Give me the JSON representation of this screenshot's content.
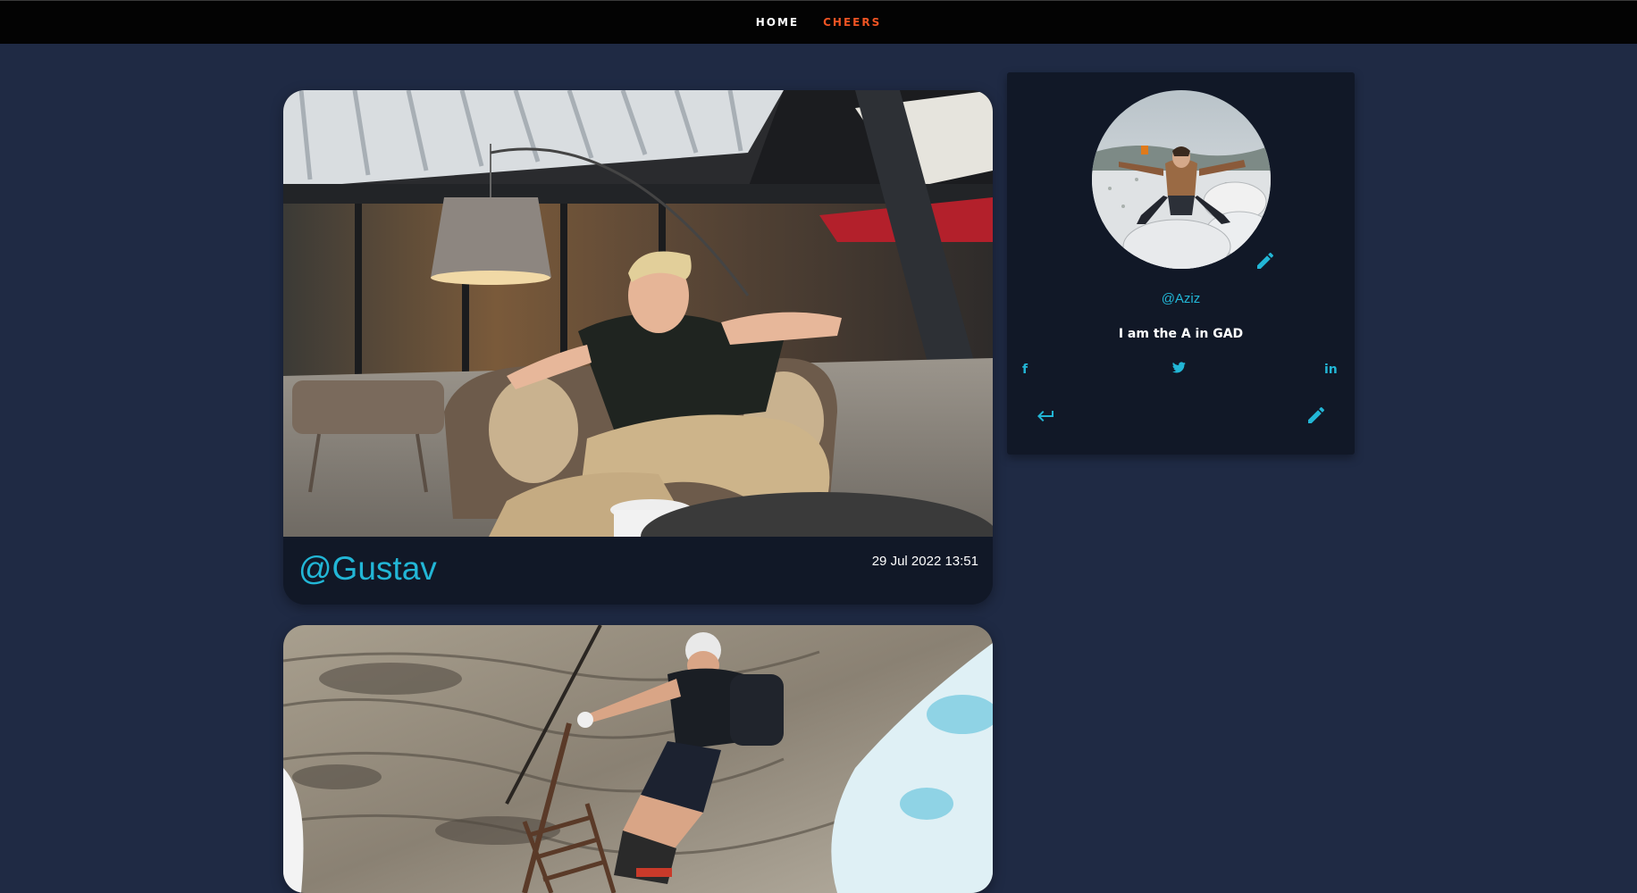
{
  "nav": {
    "home_label": "HOME",
    "cheers_label": "CHEERS"
  },
  "colors": {
    "background": "#1f2a44",
    "card": "#111827",
    "accent": "#22b6d6",
    "nav_active": "#f05423"
  },
  "posts": [
    {
      "author": "@Gustav",
      "date": "29 Jul 2022 13:51",
      "photo": "person-in-lounge-chair-photo"
    },
    {
      "photo": "climber-on-rock-wall-photo"
    }
  ],
  "profile": {
    "username": "@Aziz",
    "bio": "I am the A in GAD",
    "avatar": "person-in-snow-photo",
    "social": {
      "facebook": "f",
      "twitter": "twitter-icon",
      "linkedin": "in"
    },
    "icons": {
      "avatar_edit": "pencil-icon",
      "back": "return-arrow-icon",
      "edit": "pencil-icon"
    }
  }
}
